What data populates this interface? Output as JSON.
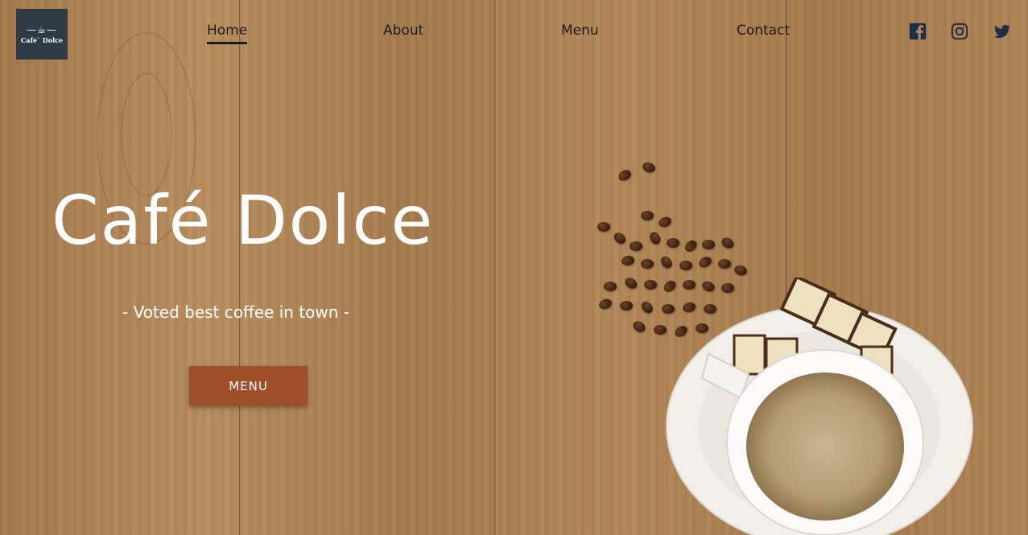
{
  "logo": {
    "cup_glyph": "—☕—",
    "text": "Cafe` Dolce"
  },
  "nav": {
    "items": [
      {
        "label": "Home",
        "active": true
      },
      {
        "label": "About",
        "active": false
      },
      {
        "label": "Menu",
        "active": false
      },
      {
        "label": "Contact",
        "active": false
      }
    ]
  },
  "social": {
    "icons": [
      "facebook-icon",
      "instagram-icon",
      "twitter-icon"
    ],
    "color": "#1b2e4a"
  },
  "hero": {
    "title": "Café Dolce",
    "subtitle": "- Voted best coffee in town -",
    "button_label": "MENU"
  },
  "colors": {
    "button": "#a14e2d",
    "logo_bg": "#2e3b47",
    "nav_text": "#1b1b1b",
    "hero_text": "#ffffff"
  }
}
